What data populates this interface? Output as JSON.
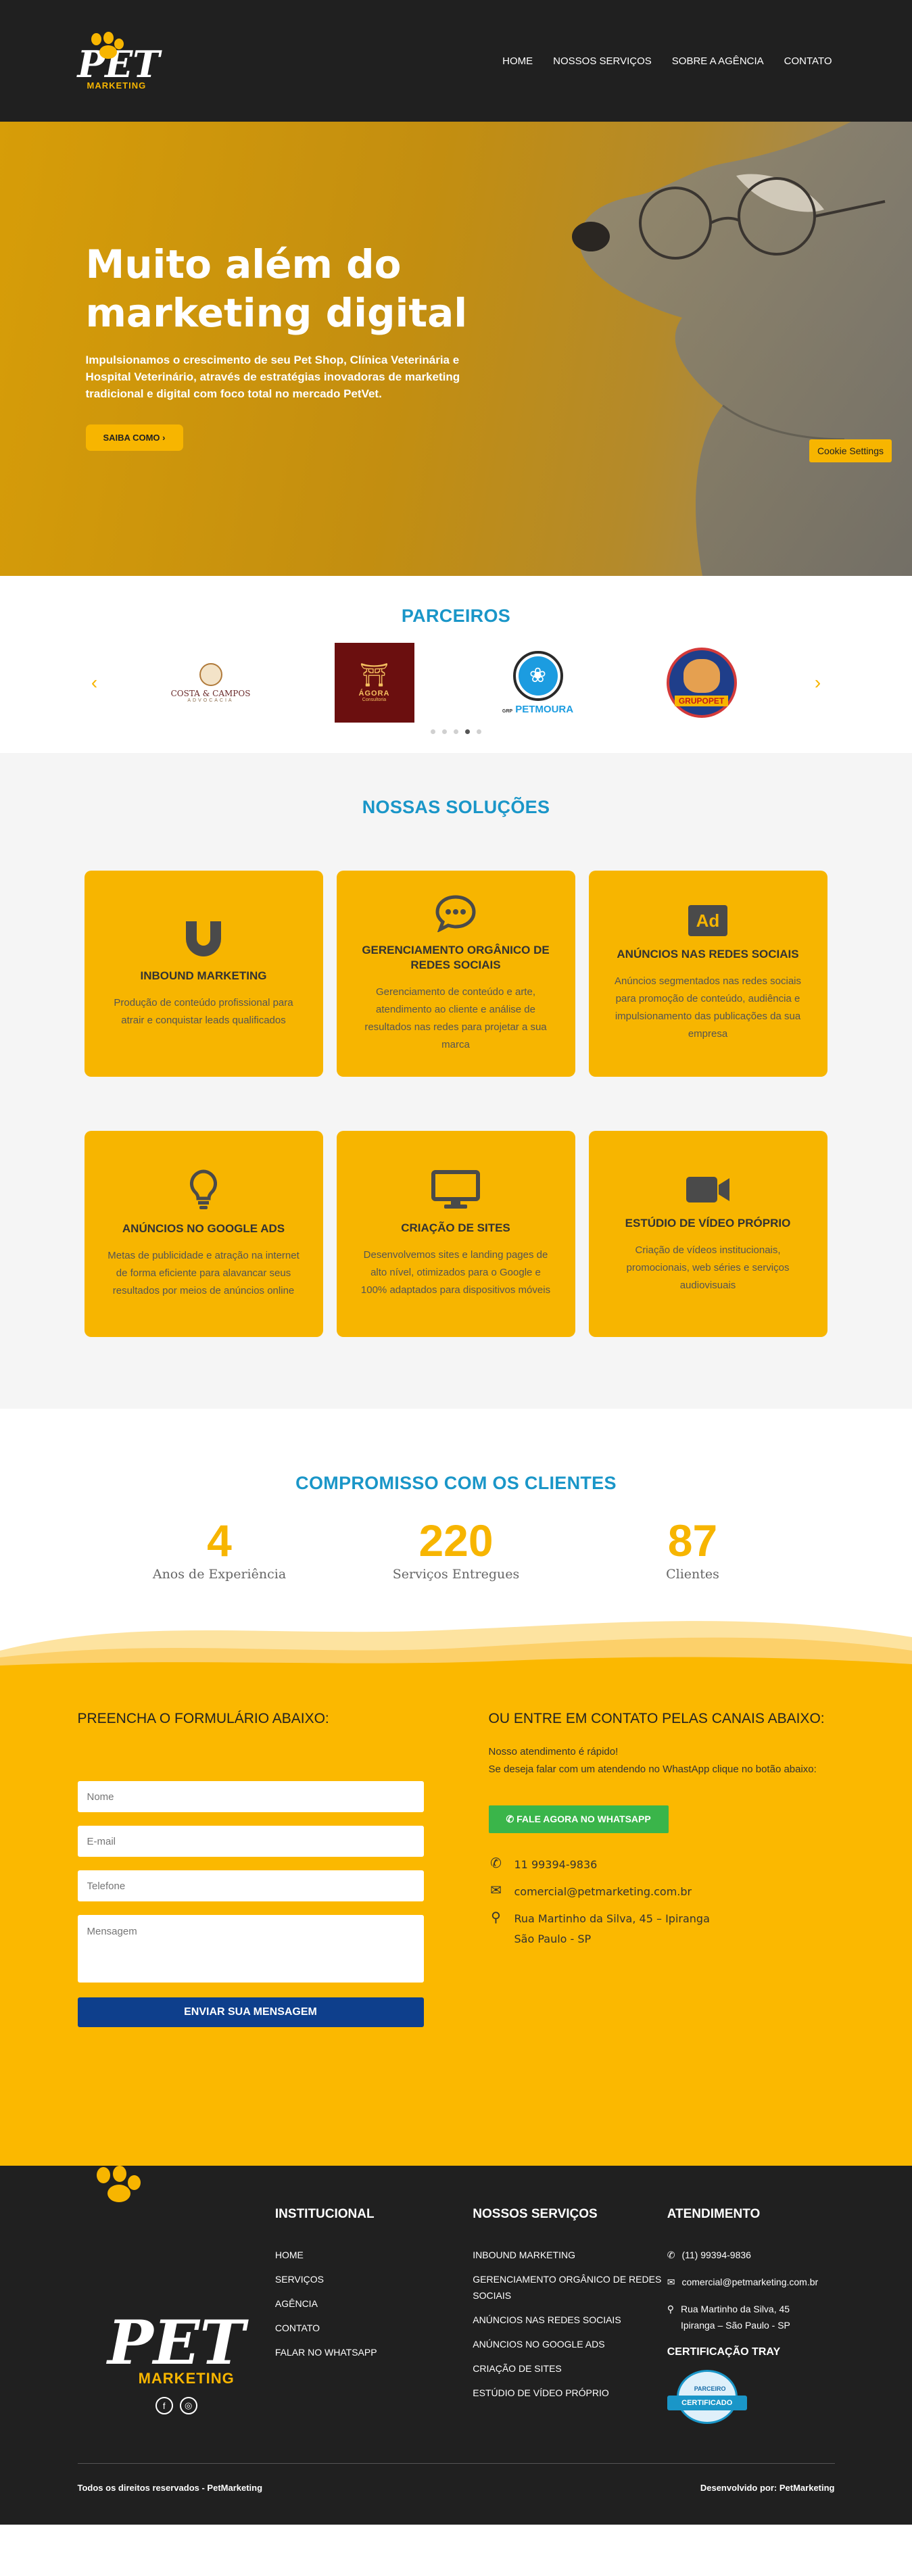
{
  "header": {
    "logo_text": "PET",
    "logo_sub": "MARKETING",
    "nav": [
      "HOME",
      "NOSSOS SERVIÇOS",
      "SOBRE A AGÊNCIA",
      "CONTATO"
    ]
  },
  "hero": {
    "title": "Muito além do marketing digital",
    "subtitle": "Impulsionamos o crescimento de seu Pet Shop, Clínica Veterinária e Hospital Veterinário, através de estratégias inovadoras de marketing tradicional e digital com foco total no mercado PetVet.",
    "button": "SAIBA COMO",
    "cookie_button": "Cookie Settings"
  },
  "partners": {
    "title": "PARCEIROS",
    "logos": [
      {
        "name": "COSTA & CAMPOS",
        "sub": "ADVOCACIA"
      },
      {
        "name": "ÁGORA",
        "sub": "Consultoria"
      },
      {
        "name": "PETMOURA",
        "sub": "GRP"
      },
      {
        "name": "GRUPOPET",
        "sub": ""
      }
    ],
    "active_dot": 3,
    "dot_count": 5
  },
  "solutions": {
    "title": "NOSSAS SOLUÇÕES",
    "items": [
      {
        "title": "INBOUND MARKETING",
        "text": "Produção de conteúdo profissional para atrair e conquistar leads qualificados",
        "icon": "magnet-icon"
      },
      {
        "title": "GERENCIAMENTO ORGÂNICO DE REDES SOCIAIS",
        "text": "Gerenciamento de conteúdo e arte, atendimento ao cliente e análise de resultados nas redes para projetar a sua marca",
        "icon": "chat-icon"
      },
      {
        "title": "ANÚNCIOS NAS REDES SOCIAIS",
        "text": "Anúncios segmentados nas redes sociais para promoção de conteúdo, audiência e impulsionamento das publicações da sua empresa",
        "icon": "ad-icon"
      },
      {
        "title": "ANÚNCIOS NO GOOGLE ADS",
        "text": "Metas de publicidade e atração na internet de forma eficiente para alavancar seus resultados por meios de anúncios online",
        "icon": "lightbulb-icon"
      },
      {
        "title": "CRIAÇÃO DE SITES",
        "text": "Desenvolvemos sites e landing pages de alto nível, otimizados para o Google e 100% adaptados para dispositivos móveis",
        "icon": "monitor-icon"
      },
      {
        "title": "ESTÚDIO DE VÍDEO PRÓPRIO",
        "text": "Criação de vídeos institucionais, promocionais, web séries e serviços audiovisuais",
        "icon": "video-camera-icon"
      }
    ]
  },
  "commitment": {
    "title": "COMPROMISSO COM OS CLIENTES",
    "stats": [
      {
        "value": "4",
        "label": "Anos de Experiência"
      },
      {
        "value": "220",
        "label": "Serviços Entregues"
      },
      {
        "value": "87",
        "label": "Clientes"
      }
    ]
  },
  "contact": {
    "form_title": "PREENCHA O FORMULÁRIO ABAIXO:",
    "name_placeholder": "Nome",
    "email_placeholder": "E-mail",
    "phone_placeholder": "Telefone",
    "message_placeholder": "Mensagem",
    "submit": "ENVIAR SUA MENSAGEM",
    "channels_title": "OU ENTRE EM CONTATO PELAS CANAIS ABAIXO:",
    "intro_1": "Nosso atendimento é rápido!",
    "intro_2": "Se deseja falar com um atendendo no WhastApp clique no botão abaixo:",
    "whatsapp_button": "FALE AGORA NO WHATSAPP",
    "phone": "11 99394-9836",
    "email": "comercial@petmarketing.com.br",
    "address_1": "Rua Martinho da Silva, 45 – Ipiranga",
    "address_2": "São Paulo - SP"
  },
  "footer": {
    "institutional": {
      "title": "INSTITUCIONAL",
      "links": [
        "HOME",
        "SERVIÇOS",
        "AGÊNCIA",
        "CONTATO",
        "FALAR NO WHATSAPP"
      ]
    },
    "services": {
      "title": "NOSSOS SERVIÇOS",
      "links": [
        "INBOUND MARKETING",
        "GERENCIAMENTO ORGÂNICO DE REDES SOCIAIS",
        "ANÚNCIOS NAS REDES SOCIAIS",
        "ANÚNCIOS NO GOOGLE ADS",
        "CRIAÇÃO DE SITES",
        "ESTÚDIO DE VÍDEO PRÓPRIO"
      ]
    },
    "support": {
      "title": "ATENDIMENTO",
      "phone": "(11) 99394-9836",
      "email": "comercial@petmarketing.com.br",
      "address_1": "Rua Martinho da Silva, 45",
      "address_2": "Ipiranga – São Paulo - SP",
      "cert_title": "CERTIFICAÇÃO TRAY",
      "badge_top": "PARCEIRO",
      "badge_main": "CERTIFICADO"
    },
    "copyright": "Todos os direitos reservados - PetMarketing",
    "developer": "Desenvolvido por: PetMarketing"
  },
  "colors": {
    "brand_yellow": "#f7b500",
    "title_blue": "#1a96c8",
    "dark": "#202020",
    "navy_button": "#0e3f8c",
    "whatsapp_green": "#3ab54a"
  }
}
